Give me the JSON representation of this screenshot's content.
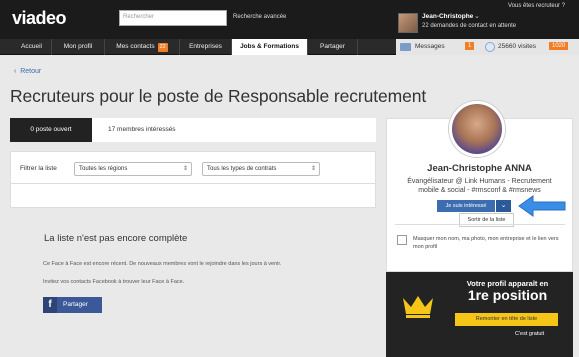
{
  "header": {
    "logo_text": "viadeo",
    "search_placeholder": "Rechercher",
    "advanced_search": "Recherche avancée",
    "user_name": "Jean-Christophe",
    "user_sub": "22 demandes de contact en attente",
    "recruiter_link": "Vous êtes recruteur ?"
  },
  "nav": {
    "items": [
      {
        "label": "Accueil"
      },
      {
        "label": "Mon profil"
      },
      {
        "label": "Mes contacts",
        "badge": "22"
      },
      {
        "label": "Entreprises"
      },
      {
        "label": "Jobs & Formations"
      },
      {
        "label": "Partager"
      }
    ],
    "messages_label": "Messages",
    "messages_count": "1",
    "visits_label": "25660 visites",
    "visits_badge": "1020"
  },
  "page": {
    "back_label": "Retour",
    "title": "Recruteurs pour le poste de Responsable recrutement",
    "tab_active": "0 poste ouvert",
    "tab_inactive": "17 membres intéressés",
    "filter_label": "Filtrer la liste",
    "filter_region": "Toutes les régions",
    "filter_contract": "Tous les types de contrats",
    "empty_title": "La liste n'est pas encore complète",
    "empty_line1": "Ce Face à Face est encore récent. De nouveaux membres vont le rejoindre dans les jours à venir.",
    "empty_line2": "Invitez vos contacts Facebook à trouver leur Face à Face.",
    "share_label": "Partager"
  },
  "profile": {
    "name": "Jean-Christophe ANNA",
    "bio_line1": "Évangélisateur @ Link Humans - Recrutement",
    "bio_line2": "mobile & social - #rmsconf & #rmsnews",
    "interest_label": "Je suis intéressé",
    "dropdown_item": "Sortir de la liste",
    "hide_text": "Masquer mon nom, ma photo, mon entreprise et le lien vers mon profil"
  },
  "promo": {
    "line1": "Votre profil apparaît en",
    "position": "1re position",
    "button": "Remonter en tête de liste",
    "try_free": "C'est gratuit"
  },
  "colors": {
    "accent_orange": "#f07e26",
    "link_blue": "#3b6db0",
    "facebook_blue": "#3b5998",
    "promo_yellow": "#f5c518"
  }
}
